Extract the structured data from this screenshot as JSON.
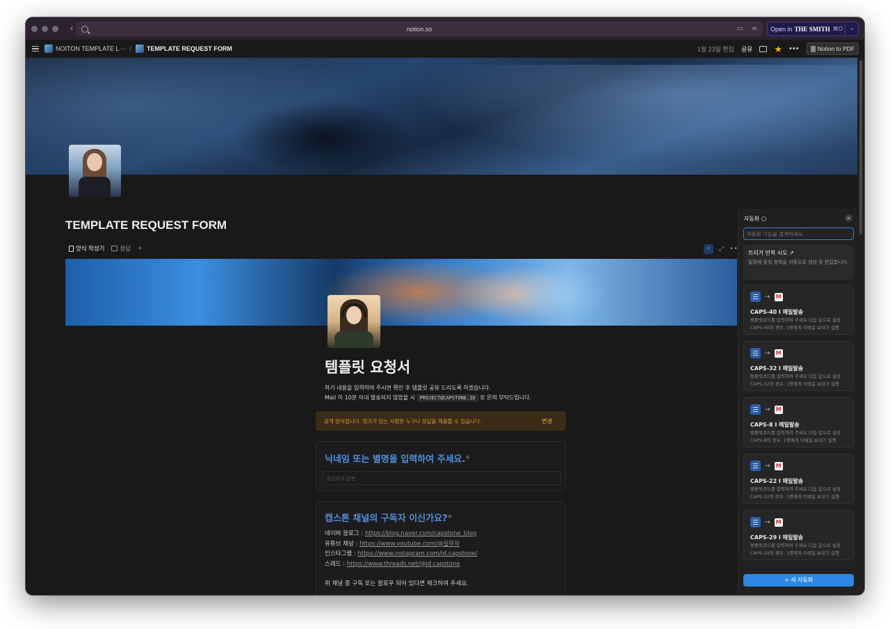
{
  "browser": {
    "url": "notion.so",
    "open_in_label": "Open in",
    "open_in_brand": "THE SMITH",
    "open_in_shortcut": "⌘O"
  },
  "topbar": {
    "breadcrumb_1": "NOITON TEMPLATE L···",
    "breadcrumb_2": "TEMPLATE REQUEST FORM",
    "edited": "1월 23일 편집",
    "share": "공유",
    "pdf_button": "Notion to PDF"
  },
  "page": {
    "title": "TEMPLATE REQUEST FORM",
    "tabs": [
      {
        "label": "양식 작성기"
      },
      {
        "label": "응답"
      }
    ]
  },
  "form": {
    "title": "템플릿 요청서",
    "desc_line1": "하기 내용을 입력하여 주시면 확인 후 템플릿 공유 드리도록 하겠습니다.",
    "desc_line2_pre": "Mail 이 10분 이내 발송되지 않았을 시",
    "desc_line2_code": "PROJECT@CAPSTONE.ID",
    "desc_line2_post": "로 문의 부탁드립니다.",
    "notice": "공개 양식입니다. 링크가 있는 사람은 누구나 응답을 제출할 수 있습니다.",
    "notice_action": "변경",
    "q1": {
      "label": "닉네임 또는 별명을 입력하여 주세요.",
      "required": "*",
      "placeholder": "응답자의 답변"
    },
    "q2": {
      "label": "캡스톤 채널의 구독자 이신가요?",
      "required": "*",
      "blog_label": "네이버 블로그 :",
      "blog_url": "https://blog.naver.com/capstone_blog",
      "youtube_label": "유튜브 채널 :",
      "youtube_url": "https://www.youtube.com/@실무자",
      "insta_label": "인스타그램 :",
      "insta_url": "https://www.instagram.com/id.capstone/",
      "threads_label": "스레드 :",
      "threads_url": "https://www.threads.net/@id.capstone",
      "check_text": "위 채널 중 구독 또는 팔로우 되어 있다면 체크하여 주세요."
    }
  },
  "automation": {
    "title": "자동화",
    "search_placeholder": "자동화 기능을 검색하세요",
    "trigger_title": "트리거 반복 시도 ↗",
    "trigger_desc": "일정에 맞춰 항목을 자동으로 생성 및 편집합니다.",
    "items": [
      {
        "name": "CAPS-40 I 메일발송",
        "desc1": "템플릿코드를 입력하여 주세요 다음 값으로 설정",
        "desc2": "CAPS-40의 경우, 1명에게 이메일 보내기 실행"
      },
      {
        "name": "CAPS-32 I 메일발송",
        "desc1": "템플릿코드를 입력하여 주세요 다음 값으로 설정",
        "desc2": "CAPS-32의 경우, 1명에게 이메일 보내기 실행"
      },
      {
        "name": "CAPS-8 I 메일발송",
        "desc1": "템플릿코드를 입력하여 주세요 다음 값으로 설정",
        "desc2": "CAPS-8의 경우, 1명에게 이메일 보내기 실행"
      },
      {
        "name": "CAPS-22 I 메일발송",
        "desc1": "템플릿코드를 입력하여 주세요 다음 값으로 설정",
        "desc2": "CAPS-22의 경우, 1명에게 이메일 보내기 실행"
      },
      {
        "name": "CAPS-29 I 메일발송",
        "desc1": "템플릿코드를 입력하여 주세요 다음 값으로 설정",
        "desc2": "CAPS-29의 경우, 1명에게 이메일 보내기 실행"
      }
    ],
    "new_button": "+ 새 자동화"
  },
  "icons": {
    "back": "chevron-left-icon",
    "search": "search-icon",
    "star": "star-icon",
    "gmail": "gmail-icon",
    "database": "database-icon"
  },
  "colors": {
    "accent_blue": "#2e87e4",
    "question_blue": "#4f8fe0",
    "notice_text": "#d79b3d",
    "star": "#f2b705"
  }
}
